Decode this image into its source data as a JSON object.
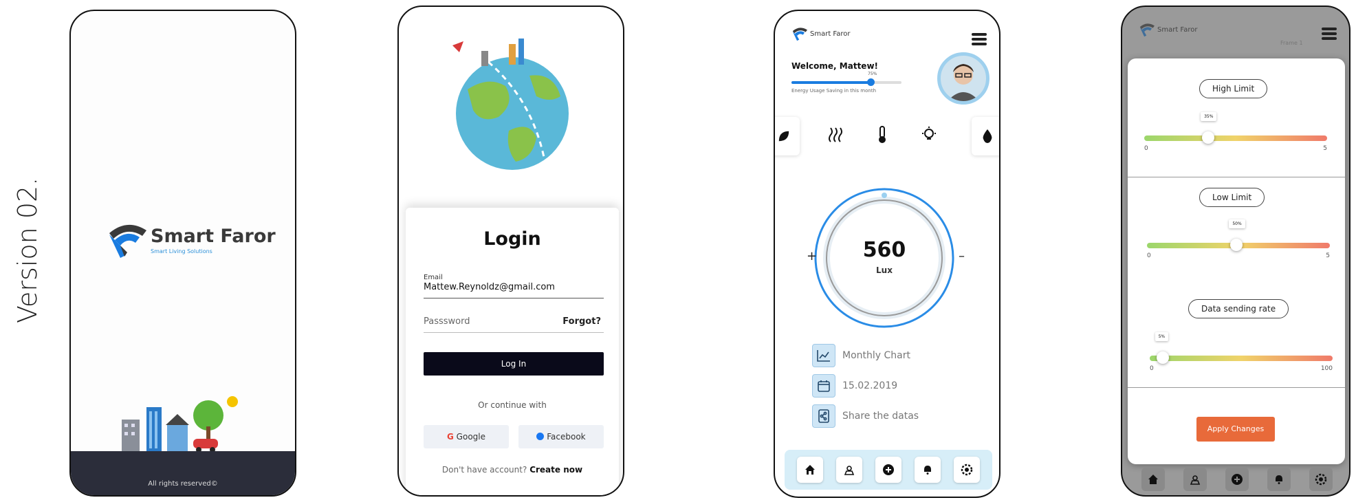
{
  "version_label": "Version 02.",
  "splash": {
    "brand": "Smart Faror",
    "tagline": "Smart Living Solutions",
    "footer": "All rights reserved©"
  },
  "login": {
    "title": "Login",
    "email_label": "Email",
    "email_value": "Mattew.Reynoldz@gmail.com",
    "password_placeholder": "Passsword",
    "forgot": "Forgot?",
    "login_button": "Log In",
    "or_continue": "Or continue with",
    "google": "Google",
    "facebook": "Facebook",
    "no_account": "Don't have account?",
    "create_now": "Create now"
  },
  "dashboard": {
    "brand": "Smart Faror",
    "welcome": "Welcome, Mattew!",
    "energy_label": "Energy Usage Saving in this month",
    "energy_pct_text": "75%",
    "energy_fraction": 0.72,
    "lux_value": "560",
    "lux_unit": "Lux",
    "plus": "+",
    "minus": "–",
    "items": [
      {
        "label": "Monthly Chart",
        "icon": "chart-icon"
      },
      {
        "label": "15.02.2019",
        "icon": "calendar-icon"
      },
      {
        "label": "Share the datas",
        "icon": "share-icon"
      }
    ],
    "device_icons": [
      "leaf-icon",
      "heater-icon",
      "thermometer-icon",
      "bulb-icon",
      "drop-icon"
    ],
    "nav_icons": [
      "home-icon",
      "map-icon",
      "add-icon",
      "bell-icon",
      "settings-icon"
    ],
    "accent": "#1a7ce0"
  },
  "settings": {
    "brand": "Smart Faror",
    "frame_label": "Frame 1",
    "high_limit": {
      "label": "High Limit",
      "bubble": "35%",
      "min": "0",
      "max": "5",
      "fraction": 0.35
    },
    "low_limit": {
      "label": "Low Limit",
      "bubble": "50%",
      "min": "0",
      "max": "5",
      "fraction": 0.49
    },
    "rate": {
      "label": "Data sending rate",
      "bubble": "5%",
      "min": "0",
      "max": "100",
      "fraction": 0.07
    },
    "apply": "Apply Changes",
    "apply_color": "#e86a3a"
  }
}
